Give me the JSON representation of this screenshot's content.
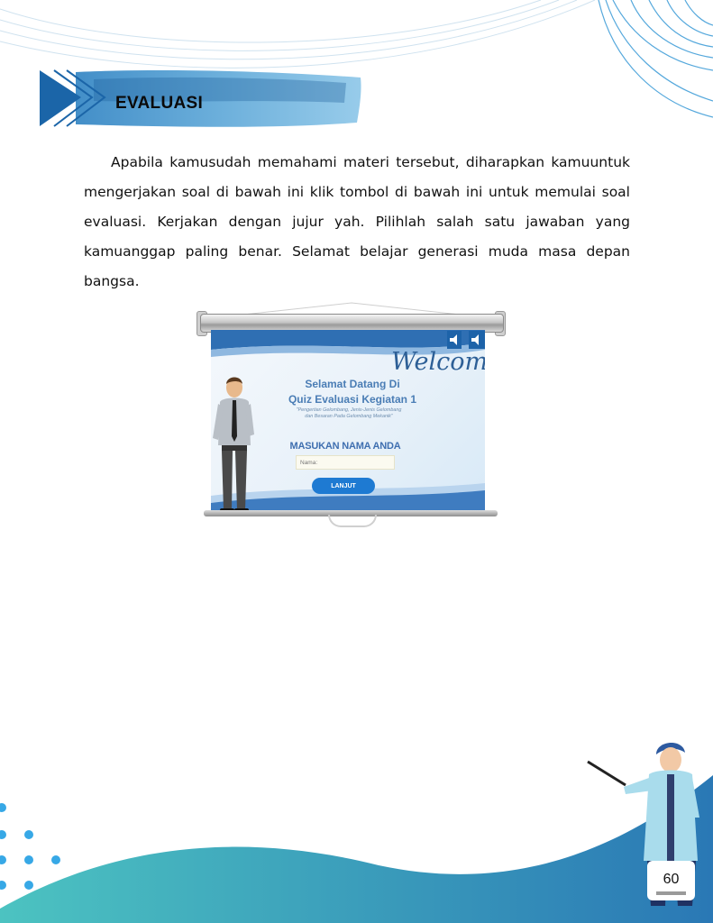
{
  "header": {
    "title": "EVALUASI"
  },
  "intro_paragraph": "Apabila kamusudah memahami materi tersebut, diharapkan kamuuntuk mengerjakan soal di bawah ini klik tombol di bawah ini untuk memulai soal evaluasi. Kerjakan dengan jujur yah. Pilihlah salah satu jawaban yang kamuanggap paling benar. Selamat belajar generasi muda masa depan bangsa.",
  "quiz_slide": {
    "welcome": "Welcome",
    "title_line1": "Selamat Datang Di",
    "title_line2": "Quiz Evaluasi Kegiatan 1",
    "subtitle_line1": "\"Pengertian Gelombang, Jenis-Jenis Gelombang",
    "subtitle_line2": "dan Besaran Pada Gelombang Mekanik\"",
    "prompt": "MASUKAN NAMA ANDA",
    "name_input_placeholder": "Nama:",
    "continue_button": "LANJUT",
    "icons": [
      "speaker-icon",
      "speaker-icon"
    ]
  },
  "page_number": "60",
  "colors": {
    "banner_blue": "#2f86c4",
    "footer_teal": "#4cc3c1",
    "footer_blue": "#2a78b5",
    "button_blue": "#1e7ad2"
  }
}
